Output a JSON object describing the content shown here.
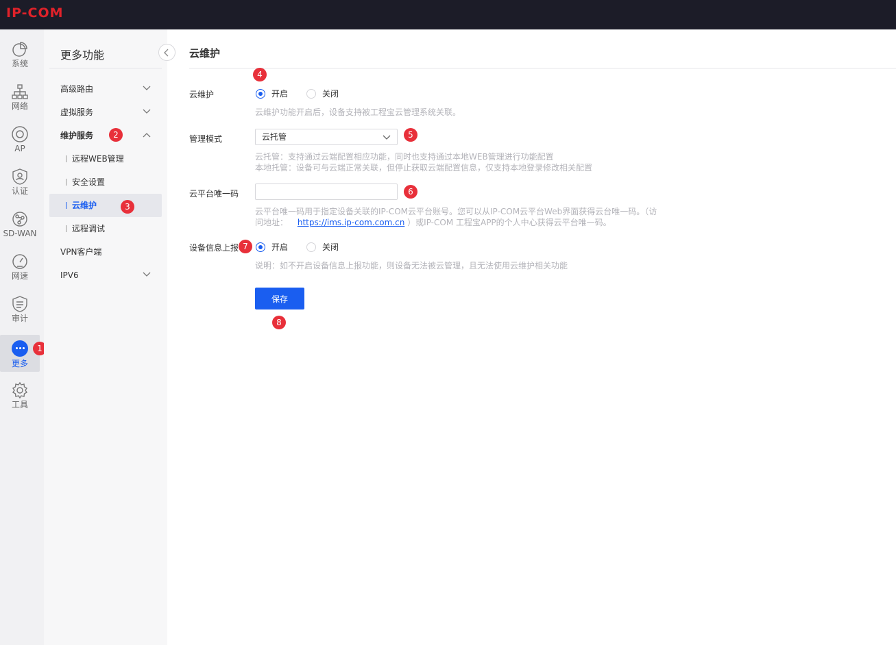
{
  "header": {
    "logo": "IP-COM"
  },
  "rail": {
    "items": [
      {
        "label": "系统",
        "icon": "pie-chart-icon"
      },
      {
        "label": "网络",
        "icon": "network-topology-icon"
      },
      {
        "label": "AP",
        "icon": "access-point-icon"
      },
      {
        "label": "认证",
        "icon": "shield-user-icon"
      },
      {
        "label": "SD-WAN",
        "icon": "sdwan-icon"
      },
      {
        "label": "网速",
        "icon": "speed-gauge-icon"
      },
      {
        "label": "审计",
        "icon": "audit-shield-icon"
      },
      {
        "label": "更多",
        "icon": "more-dots-icon",
        "active": true
      },
      {
        "label": "工具",
        "icon": "gear-icon"
      }
    ]
  },
  "submenu": {
    "title": "更多功能",
    "items": [
      {
        "label": "高级路由"
      },
      {
        "label": "虚拟服务"
      },
      {
        "label": "维护服务"
      },
      {
        "label": "远程WEB管理"
      },
      {
        "label": "安全设置"
      },
      {
        "label": "云维护"
      },
      {
        "label": "远程调试"
      },
      {
        "label": "VPN客户端"
      },
      {
        "label": "IPV6"
      }
    ]
  },
  "badges": [
    "1",
    "2",
    "3",
    "4",
    "5",
    "6",
    "7",
    "8"
  ],
  "main": {
    "title": "云维护",
    "cloud_maintenance": {
      "label": "云维护",
      "on_label": "开启",
      "off_label": "关闭",
      "hint": "云维护功能开启后，设备支持被工程宝云管理系统关联。"
    },
    "management_mode": {
      "label": "管理模式",
      "value": "云托管",
      "hint_line1": "云托管：支持通过云端配置相应功能，同时也支持通过本地WEB管理进行功能配置",
      "hint_line2": "本地托管：设备可与云端正常关联，但停止获取云端配置信息，仅支持本地登录修改相关配置"
    },
    "platform_code": {
      "label": "云平台唯一码",
      "value": "",
      "hint_line1": "云平台唯一码用于指定设备关联的IP-COM云平台账号。您可以从IP-COM云平台Web界面获得云台唯一码。（访",
      "hint_prefix": "问地址：",
      "hint_link": "https://ims.ip-com.com.cn",
      "hint_suffix": "）或IP-COM 工程宝APP的个人中心获得云平台唯一码。"
    },
    "device_report": {
      "label": "设备信息上报",
      "on_label": "开启",
      "off_label": "关闭",
      "hint": "说明：如不开启设备信息上报功能，则设备无法被云管理，且无法使用云维护相关功能"
    },
    "save_label": "保存"
  }
}
